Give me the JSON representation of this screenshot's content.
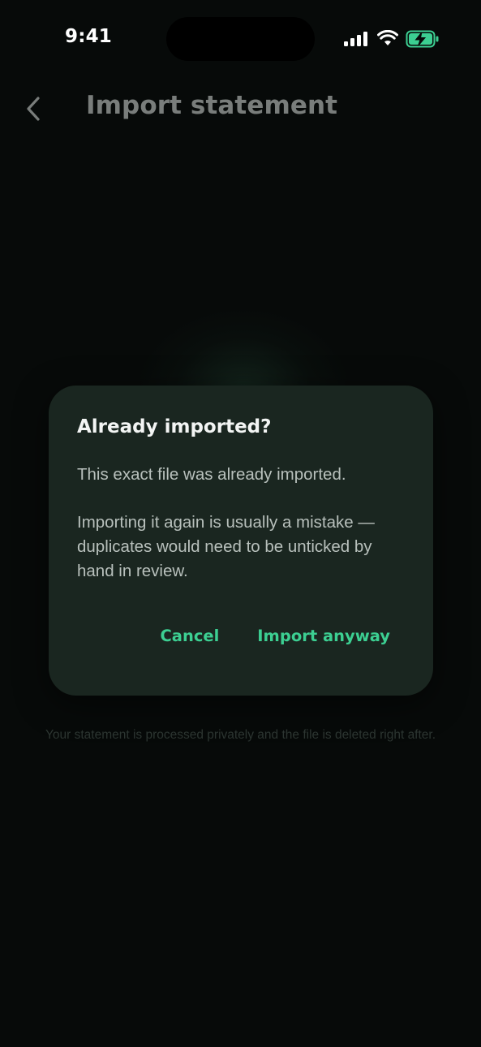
{
  "status_bar": {
    "time": "9:41",
    "icons": [
      "signal-icon",
      "wifi-icon",
      "battery-charging-icon"
    ],
    "battery_color": "#3ccf92"
  },
  "header": {
    "back_icon": "chevron-left-icon",
    "title": "Import statement"
  },
  "footnote": "Your statement is processed privately and the file is deleted right after.",
  "dialog": {
    "title": "Already imported?",
    "message_1": "This exact file was already imported.",
    "message_2": "Importing it again is usually a mistake — duplicates would need to be unticked by hand in review.",
    "cancel_label": "Cancel",
    "confirm_label": "Import anyway"
  },
  "colors": {
    "background": "#070a09",
    "dialog_background": "#1a2620",
    "accent": "#3ccf92"
  }
}
